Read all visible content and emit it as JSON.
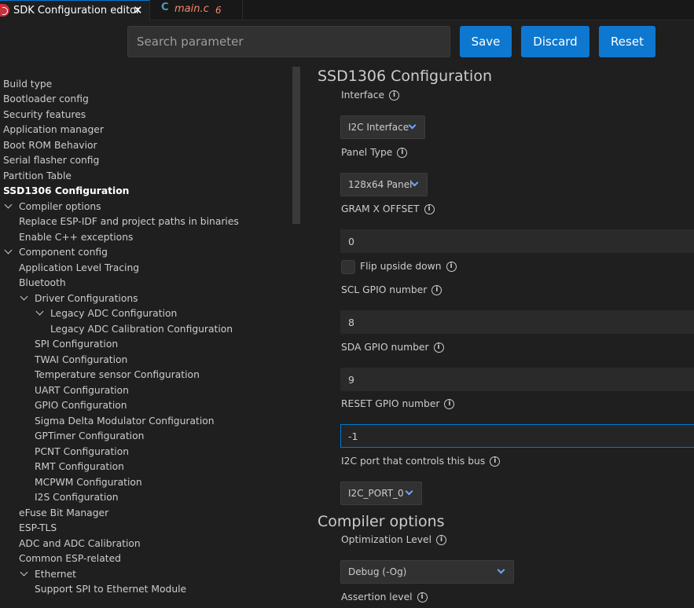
{
  "tabs": [
    {
      "label": "SDK Configuration editor",
      "close": "✕"
    },
    {
      "icon": "C",
      "label": "main.c",
      "badge": "6"
    }
  ],
  "toolbar": {
    "search_placeholder": "Search parameter",
    "save_label": "Save",
    "discard_label": "Discard",
    "reset_label": "Reset"
  },
  "sidebar": {
    "items": [
      {
        "label": "Build type"
      },
      {
        "label": "Bootloader config"
      },
      {
        "label": "Security features"
      },
      {
        "label": "Application manager"
      },
      {
        "label": "Boot ROM Behavior"
      },
      {
        "label": "Serial flasher config"
      },
      {
        "label": "Partition Table"
      },
      {
        "label": "SSD1306 Configuration"
      },
      {
        "label": "Compiler options"
      },
      {
        "label": "Replace ESP-IDF and project paths in binaries"
      },
      {
        "label": "Enable C++ exceptions"
      },
      {
        "label": "Component config"
      },
      {
        "label": "Application Level Tracing"
      },
      {
        "label": "Bluetooth"
      },
      {
        "label": "Driver Configurations"
      },
      {
        "label": "Legacy ADC Configuration"
      },
      {
        "label": "Legacy ADC Calibration Configuration"
      },
      {
        "label": "SPI Configuration"
      },
      {
        "label": "TWAI Configuration"
      },
      {
        "label": "Temperature sensor Configuration"
      },
      {
        "label": "UART Configuration"
      },
      {
        "label": "GPIO Configuration"
      },
      {
        "label": "Sigma Delta Modulator Configuration"
      },
      {
        "label": "GPTimer Configuration"
      },
      {
        "label": "PCNT Configuration"
      },
      {
        "label": "RMT Configuration"
      },
      {
        "label": "MCPWM Configuration"
      },
      {
        "label": "I2S Configuration"
      },
      {
        "label": "eFuse Bit Manager"
      },
      {
        "label": "ESP-TLS"
      },
      {
        "label": "ADC and ADC Calibration"
      },
      {
        "label": "Common ESP-related"
      },
      {
        "label": "Ethernet"
      },
      {
        "label": "Support SPI to Ethernet Module"
      }
    ]
  },
  "main": {
    "ssd1306": {
      "title": "SSD1306 Configuration",
      "interface_label": "Interface",
      "interface_value": "I2C Interface",
      "panel_label": "Panel Type",
      "panel_value": "128x64 Panel",
      "gram_label": "GRAM X OFFSET",
      "gram_value": "0",
      "flip_label": "Flip upside down",
      "scl_label": "SCL GPIO number",
      "scl_value": "8",
      "sda_label": "SDA GPIO number",
      "sda_value": "9",
      "reset_label": "RESET GPIO number",
      "reset_value": "-1",
      "port_label": "I2C port that controls this bus",
      "port_value": "I2C_PORT_0"
    },
    "compiler": {
      "title": "Compiler options",
      "opt_label": "Optimization Level",
      "opt_value": "Debug (-Og)",
      "assert_label": "Assertion level"
    }
  },
  "colors": {
    "accent": "#0e78d0",
    "focus": "#0078d4",
    "error": "#f48771",
    "chevron": "#6ca6ff"
  }
}
